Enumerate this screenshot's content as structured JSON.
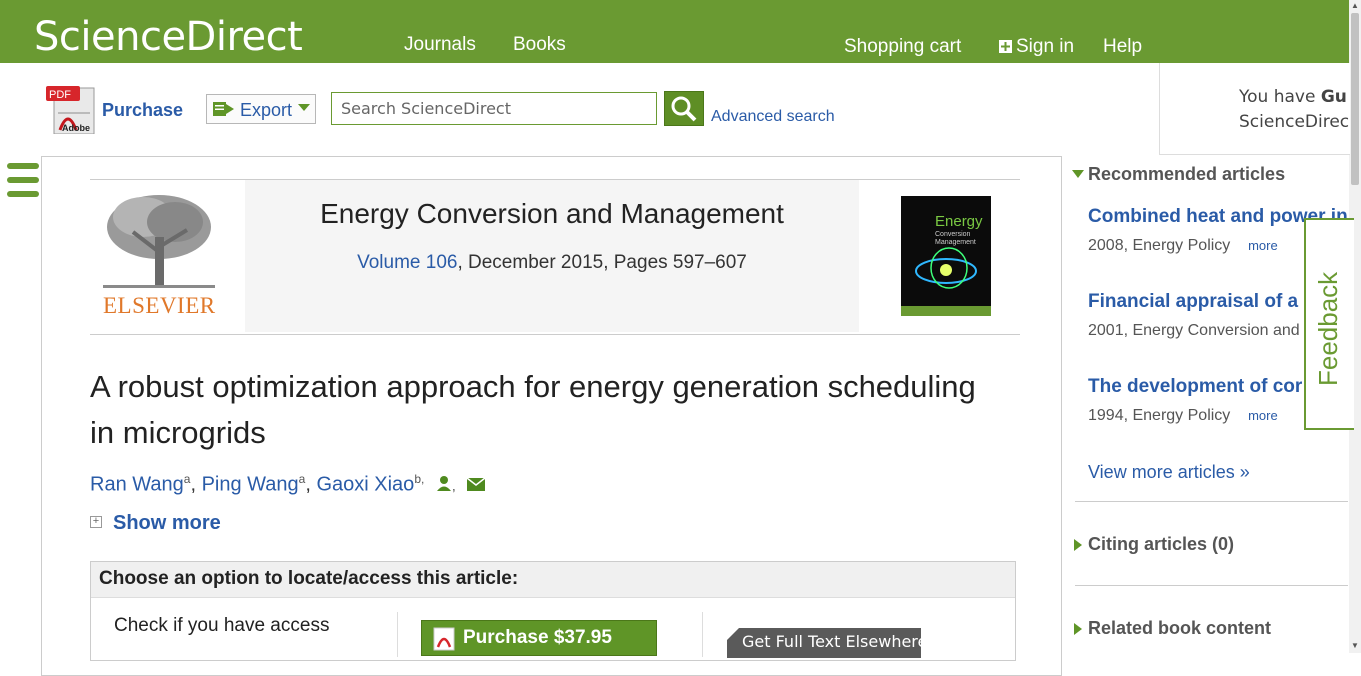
{
  "header": {
    "brand": "ScienceDirect",
    "nav": {
      "journals": "Journals",
      "books": "Books"
    },
    "shopping_cart": "Shopping cart",
    "sign_in": "Sign in",
    "help": "Help",
    "brand_color": "#6a9a32"
  },
  "toolbar": {
    "pdf_icon_label": "PDF",
    "adobe_label": "Adobe",
    "purchase": "Purchase",
    "export": "Export",
    "search_placeholder": "Search ScienceDirect",
    "advanced_search": "Advanced search"
  },
  "guest": {
    "line1_prefix": "You have ",
    "line1_bold": "Gu",
    "line2": "ScienceDirec"
  },
  "journal": {
    "publisher_logo": "ELSEVIER",
    "title": "Energy Conversion and Management",
    "volume": "Volume 106",
    "details": ", December 2015, Pages 597–607",
    "cover_title": "Energy",
    "cover_subtitle1": "Conversion",
    "cover_subtitle2": "Management"
  },
  "article": {
    "title": "A robust optimization approach for energy generation scheduling in microgrids",
    "authors": [
      {
        "name": "Ran Wang",
        "sup": "a",
        "sep": ", "
      },
      {
        "name": "Ping Wang",
        "sup": "a",
        "sep": ", "
      },
      {
        "name": "Gaoxi Xiao",
        "sup": "b,",
        "sep": ""
      }
    ],
    "author_sep_after_icon": ",",
    "show_more": "Show more"
  },
  "access": {
    "heading": "Choose an option to locate/access this article:",
    "check_text": "Check if you have access",
    "purchase_label": "Purchase $37.95",
    "fulltext_label": "Get Full Text Elsewhere"
  },
  "sidebar": {
    "recommended_heading": "Recommended articles",
    "recommended": [
      {
        "title": "Combined heat and power in",
        "meta": "2008, Energy Policy",
        "more": "more"
      },
      {
        "title": "Financial appraisal of a",
        "meta": "2001, Energy Conversion and",
        "more": ""
      },
      {
        "title": "The development of cor",
        "meta": "1994, Energy Policy",
        "more": "more"
      }
    ],
    "view_more": "View more articles »",
    "citing": "Citing articles (0)",
    "related_books": "Related book content",
    "feedback": "Feedback"
  }
}
